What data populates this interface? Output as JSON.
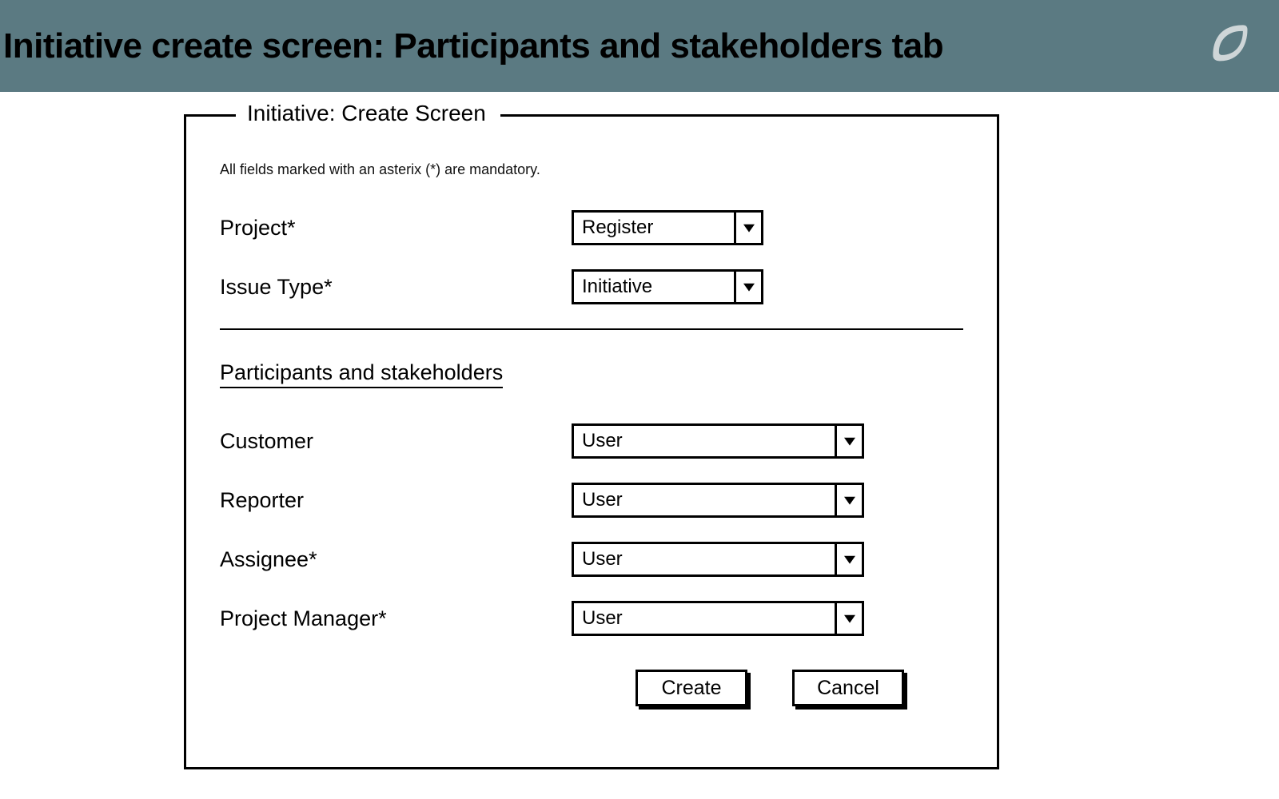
{
  "header": {
    "title": "Initiative create screen: Participants and stakeholders tab",
    "logo_icon": "leaf-icon"
  },
  "panel": {
    "legend": "Initiative: Create Screen",
    "hint": "All fields marked with an asterix (*) are mandatory.",
    "top_fields": {
      "project": {
        "label": "Project*",
        "value": "Register"
      },
      "issue_type": {
        "label": "Issue Type*",
        "value": "Initiative"
      }
    },
    "section_title": "Participants and stakeholders",
    "participant_fields": {
      "customer": {
        "label": "Customer",
        "value": "User"
      },
      "reporter": {
        "label": "Reporter",
        "value": "User"
      },
      "assignee": {
        "label": "Assignee*",
        "value": "User"
      },
      "project_manager": {
        "label": "Project Manager*",
        "value": "User"
      }
    },
    "buttons": {
      "create": "Create",
      "cancel": "Cancel"
    }
  }
}
